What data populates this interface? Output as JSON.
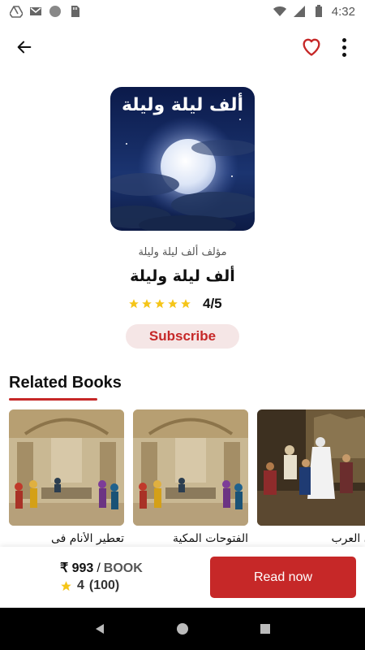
{
  "status_bar": {
    "time": "4:32",
    "icons": [
      "drive-icon",
      "gmail-icon",
      "circle-icon",
      "sd-card-icon",
      "wifi-icon",
      "signal-icon",
      "battery-icon"
    ]
  },
  "app_bar": {
    "back_icon": "arrow-left-icon",
    "favorite_icon": "heart-outline-icon",
    "more_icon": "more-vert-icon"
  },
  "book": {
    "cover_title": "ألف ليلة وليلة",
    "author": "مؤلف ألف ليلة وليلة",
    "title": "ألف ليلة وليلة",
    "rating_text": "4/5",
    "stars": 5
  },
  "subscribe_label": "Subscribe",
  "related": {
    "title": "Related Books",
    "items": [
      {
        "label": "تعطير الأنام فى"
      },
      {
        "label": "الفتوحات المكية"
      },
      {
        "label": "ن العرب"
      }
    ]
  },
  "purchase": {
    "price": "₹ 993",
    "separator": "/",
    "unit": "BOOK",
    "rating": "4",
    "rating_count": "(100)",
    "read_label": "Read now"
  },
  "colors": {
    "accent": "#c62828",
    "subscribe_bg": "#f5e6e6",
    "star": "#f5c518"
  }
}
